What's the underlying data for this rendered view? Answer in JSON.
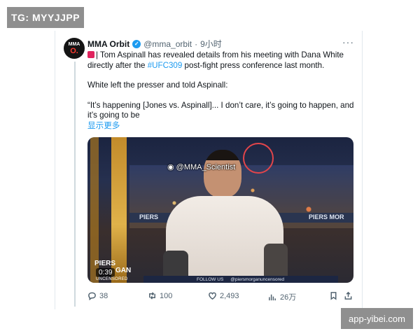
{
  "watermarks": {
    "top_left": "TG: MYYJJPP",
    "bottom_right": "app-yibei.com"
  },
  "tweet": {
    "avatar": {
      "line1": "MMA",
      "line2": "O."
    },
    "author_name": "MMA Orbit",
    "handle": "@mma_orbit",
    "separator": "·",
    "time": "9小时",
    "more": "···",
    "text_line1_prefix": "| Tom Aspinall has revealed details from his meeting with Dana White directly after the ",
    "hashtag": "#UFC309",
    "text_line1_suffix": " post-fight press conference last month.",
    "para2": "White left the presser and told Aspinall:",
    "para3": "“It’s happening [Jones vs. Aspinall]... I don’t care, it’s going to happen, and it’s going to be",
    "show_more": "显示更多"
  },
  "media": {
    "weibo_watermark": "@MMA_Scientist",
    "banner_left": "PIERS",
    "banner_right": "PIERS MOR",
    "logo_line1": "PIERS",
    "logo_line2": "GAN",
    "duration": "0:39",
    "uncensored": "UNCENSORED",
    "follow_us": "FOLLOW US",
    "social_handle": "@piersmorganuncensored"
  },
  "actions": {
    "replies": "38",
    "reposts": "100",
    "likes": "2,493",
    "views": "26万"
  },
  "colors": {
    "accent": "#1d9bf0",
    "muted": "#536471",
    "watermark_bg": "#8f8f8f"
  }
}
